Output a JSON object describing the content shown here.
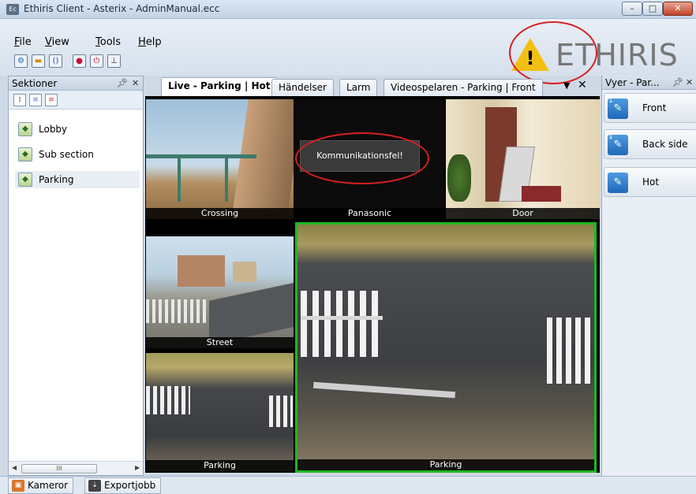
{
  "window": {
    "app_icon": "Ec",
    "title": "Ethiris Client - Asterix - AdminManual.ecc",
    "minimize": "–",
    "maximize": "□",
    "close": "✕"
  },
  "menu": {
    "file": "File",
    "view": "View",
    "tools": "Tools",
    "help": "Help"
  },
  "toolbar": {
    "icons": [
      "settings-icon",
      "folder-icon",
      "refresh-icon",
      "record-icon",
      "power-icon",
      "export-icon"
    ]
  },
  "logo": {
    "text": "ETHIRIS",
    "warning": "!"
  },
  "left_panel": {
    "title": "Sektioner",
    "pin": "ᵖ",
    "close": "✕",
    "items": [
      {
        "label": "Lobby"
      },
      {
        "label": "Sub section"
      },
      {
        "label": "Parking"
      }
    ],
    "scroll_thumb": "III"
  },
  "tabs": {
    "live": "Live - Parking | Hot",
    "events": "Händelser",
    "alarm": "Larm",
    "player": "Videospelaren - Parking | Front",
    "dropdown": "▼",
    "close": "✕"
  },
  "cameras": {
    "crossing": "Crossing",
    "panasonic": "Panasonic",
    "door": "Door",
    "street": "Street",
    "parking_small": "Parking",
    "parking_large": "Parking",
    "error_message": "Kommunikationsfel!"
  },
  "right_panel": {
    "title": "Vyer - Par...",
    "pin": "ᵖ",
    "close": "✕",
    "views": [
      {
        "label": "Front",
        "number": "1"
      },
      {
        "label": "Back side",
        "number": "1"
      },
      {
        "label": "Hot",
        "number": ""
      }
    ]
  },
  "bottom_tabs": {
    "cameras": "Kameror",
    "export": "Exportjobb"
  },
  "colors": {
    "selected_camera_border": "#1db91d",
    "annotation_circle": "#d62020",
    "logo_warning": "#f3c012"
  }
}
